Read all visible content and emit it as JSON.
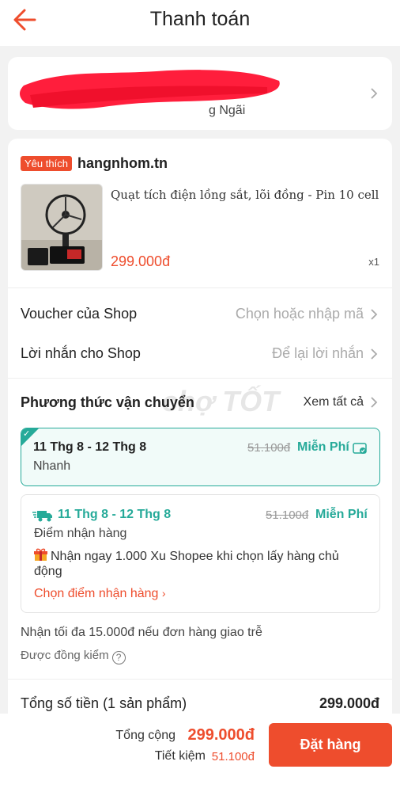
{
  "header": {
    "title": "Thanh toán",
    "back_icon": "arrow-left-icon"
  },
  "address": {
    "visible_text": "g Ngãi",
    "redacted": true
  },
  "shop": {
    "badge": "Yêu thích",
    "name": "hangnhom.tn",
    "product": {
      "name": "Quạt tích điện lồng sắt, lõi đồng - Pin 10 cell",
      "price": "299.000đ",
      "qty": "x1"
    },
    "voucher": {
      "label": "Voucher của Shop",
      "value": "Chọn hoặc nhập mã"
    },
    "message": {
      "label": "Lời nhắn cho Shop",
      "value": "Để lại lời nhắn"
    }
  },
  "shipping": {
    "title": "Phương thức vận chuyển",
    "see_all": "Xem tất cả",
    "watermark": "chợ TỐT",
    "options": [
      {
        "date": "11 Thg 8 - 12 Thg 8",
        "sub": "Nhanh",
        "old_price": "51.100đ",
        "free": "Miễn Phí",
        "selected": true
      },
      {
        "date": "11 Thg 8 - 12 Thg 8",
        "sub": "Điểm nhận hàng",
        "old_price": "51.100đ",
        "free": "Miễn Phí",
        "promo": "Nhận ngay 1.000 Xu Shopee khi chọn lấy hàng chủ động",
        "link": "Chọn điểm nhận hàng"
      }
    ],
    "late_note": "Nhận tối đa 15.000đ nếu đơn hàng giao trễ",
    "inspect_note": "Được đồng kiểm"
  },
  "summary": {
    "label": "Tổng số tiền (1 sản phẩm)",
    "value": "299.000đ"
  },
  "footer": {
    "total_label": "Tổng cộng",
    "total_value": "299.000đ",
    "save_label": "Tiết kiệm",
    "save_value": "51.100đ",
    "order_button": "Đặt hàng"
  },
  "colors": {
    "accent": "#ee4d2d",
    "teal": "#26aa99"
  }
}
